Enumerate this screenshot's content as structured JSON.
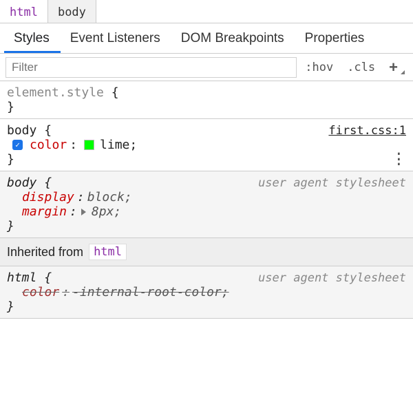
{
  "breadcrumb": {
    "items": [
      {
        "label": "html"
      },
      {
        "label": "body"
      }
    ]
  },
  "tabs": {
    "items": [
      {
        "label": "Styles"
      },
      {
        "label": "Event Listeners"
      },
      {
        "label": "DOM Breakpoints"
      },
      {
        "label": "Properties"
      }
    ]
  },
  "toolbar": {
    "filter_placeholder": "Filter",
    "hov": ":hov",
    "cls": ".cls",
    "add": "+"
  },
  "rules": {
    "element_style": {
      "selector": "element.style",
      "open": "{",
      "close": "}"
    },
    "body_author": {
      "selector": "body",
      "open": "{",
      "close": "}",
      "source": "first.css:1",
      "decl": {
        "prop": "color",
        "colon": ":",
        "swatch_color": "#00ff00",
        "value": "lime;"
      }
    },
    "body_ua": {
      "selector": "body",
      "open": "{",
      "close": "}",
      "tag": "user agent stylesheet",
      "decls": [
        {
          "prop": "display",
          "colon": ":",
          "value": "block;"
        },
        {
          "prop": "margin",
          "colon": ":",
          "value": "8px;",
          "expandable": true
        }
      ]
    },
    "inherited": {
      "label": "Inherited from",
      "from": "html"
    },
    "html_ua": {
      "selector": "html",
      "open": "{",
      "close": "}",
      "tag": "user agent stylesheet",
      "decl": {
        "prop": "color",
        "colon": ":",
        "value": "-internal-root-color;"
      }
    }
  }
}
